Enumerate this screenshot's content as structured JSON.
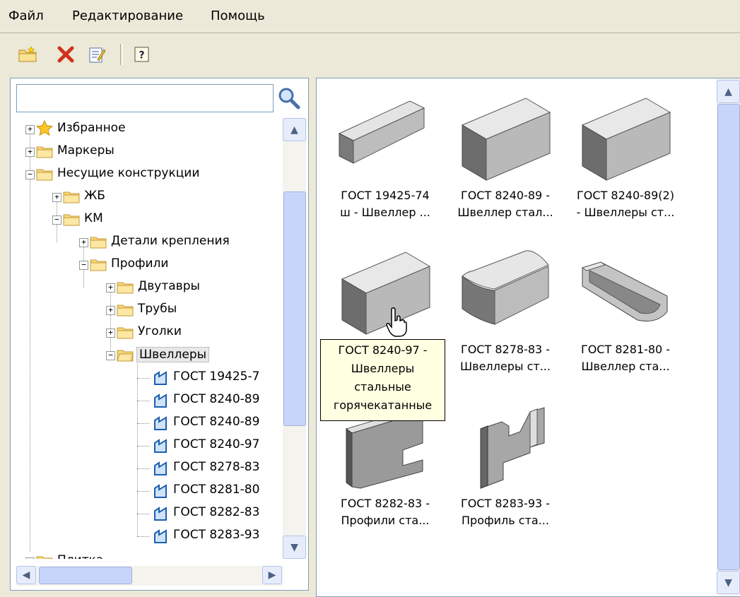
{
  "menu": [
    "Файл",
    "Редактирование",
    "Помощь"
  ],
  "toolbar": {
    "icons": [
      "new-folder-icon",
      "delete-icon",
      "edit-icon",
      "help-icon"
    ]
  },
  "search": {
    "value": "",
    "placeholder": ""
  },
  "tree": {
    "items": [
      {
        "label": "Избранное",
        "icon": "star-icon",
        "expander": "+"
      },
      {
        "label": "Маркеры",
        "icon": "folder-icon",
        "expander": "+"
      },
      {
        "label": "Несущие конструкции",
        "icon": "folder-icon",
        "expander": "−"
      },
      {
        "label": "ЖБ",
        "icon": "folder-icon",
        "expander": "+"
      },
      {
        "label": "КМ",
        "icon": "folder-icon",
        "expander": "−"
      },
      {
        "label": "Детали крепления",
        "icon": "folder-icon",
        "expander": "+"
      },
      {
        "label": "Профили",
        "icon": "folder-icon",
        "expander": "−"
      },
      {
        "label": "Двутавры",
        "icon": "folder-icon",
        "expander": "+"
      },
      {
        "label": "Трубы",
        "icon": "folder-icon",
        "expander": "+"
      },
      {
        "label": "Уголки",
        "icon": "folder-icon",
        "expander": "+"
      },
      {
        "label": "Швеллеры",
        "icon": "folder-icon",
        "expander": "−"
      },
      {
        "label": "ГОСТ 19425-7",
        "icon": "part-icon",
        "expander": ""
      },
      {
        "label": "ГОСТ 8240-89",
        "icon": "part-icon",
        "expander": ""
      },
      {
        "label": "ГОСТ 8240-89",
        "icon": "part-icon",
        "expander": ""
      },
      {
        "label": "ГОСТ 8240-97",
        "icon": "part-icon",
        "expander": ""
      },
      {
        "label": "ГОСТ 8278-83",
        "icon": "part-icon",
        "expander": ""
      },
      {
        "label": "ГОСТ 8281-80",
        "icon": "part-icon",
        "expander": ""
      },
      {
        "label": "ГОСТ 8282-83",
        "icon": "part-icon",
        "expander": ""
      },
      {
        "label": "ГОСТ 8283-93",
        "icon": "part-icon",
        "expander": ""
      },
      {
        "label": "Плитка",
        "icon": "folder-icon",
        "expander": "+"
      }
    ]
  },
  "gallery": {
    "items": [
      {
        "line1": "ГОСТ 19425-74",
        "line2": "ш - Швеллер ..."
      },
      {
        "line1": "ГОСТ 8240-89 -",
        "line2": "Швеллер стал..."
      },
      {
        "line1": "ГОСТ 8240-89(2)",
        "line2": "- Швеллеры ст..."
      },
      {
        "line1": "",
        "line2": ""
      },
      {
        "line1": "ГОСТ 8278-83 -",
        "line2": "Швеллеры ст..."
      },
      {
        "line1": "ГОСТ 8281-80 -",
        "line2": "Швеллер ста..."
      },
      {
        "line1": "ГОСТ 8282-83 -",
        "line2": "Профили ста..."
      },
      {
        "line1": "ГОСТ 8283-93 -",
        "line2": "Профиль ста..."
      }
    ]
  },
  "tooltip": {
    "lines": [
      "ГОСТ 8240-97 -",
      "Швеллеры",
      "стальные",
      "горячекатанные"
    ]
  }
}
